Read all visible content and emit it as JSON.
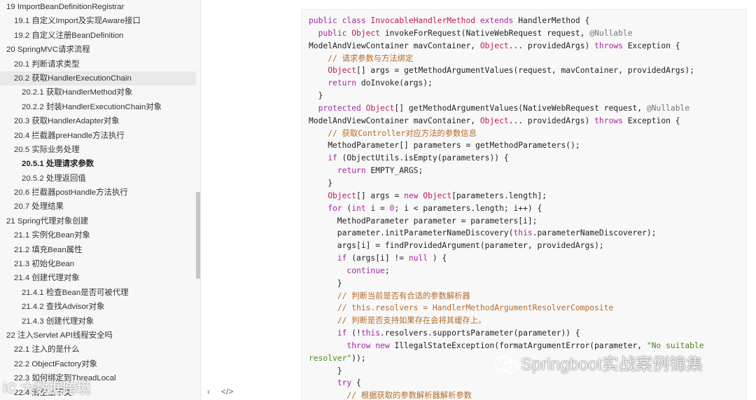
{
  "toc": [
    {
      "label": "19 ImportBeanDefinitionRegistrar",
      "level": 1
    },
    {
      "label": "19.1 自定义Import及实现Aware接口",
      "level": 2
    },
    {
      "label": "19.2 自定义注册BeanDefinition",
      "level": 2
    },
    {
      "label": "20 SpringMVC请求流程",
      "level": 1
    },
    {
      "label": "20.1 判断请求类型",
      "level": 2
    },
    {
      "label": "20.2 获取HandlerExecutionChain",
      "level": 2,
      "active": true
    },
    {
      "label": "20.2.1 获取HandlerMethod对象",
      "level": 3
    },
    {
      "label": "20.2.2 封装HandlerExecutionChain对象",
      "level": 3
    },
    {
      "label": "20.3 获取HandlerAdapter对象",
      "level": 2
    },
    {
      "label": "20.4 拦截器preHandle方法执行",
      "level": 2
    },
    {
      "label": "20.5 实际业务处理",
      "level": 2
    },
    {
      "label": "20.5.1 处理请求参数",
      "level": 3,
      "bold": true
    },
    {
      "label": "20.5.2 处理返回值",
      "level": 3
    },
    {
      "label": "20.6 拦截器postHandle方法执行",
      "level": 2
    },
    {
      "label": "20.7 处理结果",
      "level": 2
    },
    {
      "label": "21 Spring代理对象创建",
      "level": 1
    },
    {
      "label": "21.1 实例化Bean对象",
      "level": 2
    },
    {
      "label": "21.2 填充Bean属性",
      "level": 2
    },
    {
      "label": "21.3 初始化Bean",
      "level": 2
    },
    {
      "label": "21.4 创建代理对象",
      "level": 2
    },
    {
      "label": "21.4.1 检查Bean是否可被代理",
      "level": 3
    },
    {
      "label": "21.4.2 查找Advisor对象",
      "level": 3
    },
    {
      "label": "21.4.3 创建代理对象",
      "level": 3
    },
    {
      "label": "22 注入Servlet API线程安全吗",
      "level": 1
    },
    {
      "label": "22.1 注入的是什么",
      "level": 2
    },
    {
      "label": "22.2 ObjectFactory对象",
      "level": 2
    },
    {
      "label": "22.3 如何绑定到ThreadLocal",
      "level": 2
    },
    {
      "label": "22.4 清空上下文",
      "level": 2
    }
  ],
  "footer": {
    "collapse_label": "‹",
    "code_label": "</>"
  },
  "code_lines": [
    [
      [
        "kw",
        "public class "
      ],
      [
        "ty",
        "InvocableHandlerMethod"
      ],
      [
        "kw",
        " extends "
      ],
      [
        "",
        "HandlerMethod {"
      ]
    ],
    [
      [
        "",
        "  "
      ],
      [
        "kw",
        "public "
      ],
      [
        "ty",
        "Object"
      ],
      [
        "",
        " invokeForRequest(NativeWebRequest request, "
      ],
      [
        "an",
        "@Nullable"
      ]
    ],
    [
      [
        "",
        "ModelAndViewContainer mavContainer, "
      ],
      [
        "ty",
        "Object"
      ],
      [
        "",
        "... providedArgs) "
      ],
      [
        "kw",
        "throws"
      ],
      [
        "",
        " Exception {"
      ]
    ],
    [
      [
        "",
        "    "
      ],
      [
        "cm",
        "// 请求参数与方法绑定"
      ]
    ],
    [
      [
        "",
        "    "
      ],
      [
        "ty",
        "Object"
      ],
      [
        "",
        "[] args = getMethodArgumentValues(request, mavContainer, providedArgs);"
      ]
    ],
    [
      [
        "",
        "    "
      ],
      [
        "kw",
        "return"
      ],
      [
        "",
        " doInvoke(args);"
      ]
    ],
    [
      [
        "",
        "  }"
      ]
    ],
    [
      [
        "",
        "  "
      ],
      [
        "kw",
        "protected "
      ],
      [
        "ty",
        "Object"
      ],
      [
        "",
        "[] getMethodArgumentValues(NativeWebRequest request, "
      ],
      [
        "an",
        "@Nullable"
      ]
    ],
    [
      [
        "",
        "ModelAndViewContainer mavContainer, "
      ],
      [
        "ty",
        "Object"
      ],
      [
        "",
        "... providedArgs) "
      ],
      [
        "kw",
        "throws"
      ],
      [
        "",
        " Exception {"
      ]
    ],
    [
      [
        "",
        "    "
      ],
      [
        "cm",
        "// 获取Controller对应方法的参数信息"
      ]
    ],
    [
      [
        "",
        "    MethodParameter[] parameters = getMethodParameters();"
      ]
    ],
    [
      [
        "",
        "    "
      ],
      [
        "kw",
        "if"
      ],
      [
        "",
        " (ObjectUtils.isEmpty(parameters)) {"
      ]
    ],
    [
      [
        "",
        "      "
      ],
      [
        "kw",
        "return"
      ],
      [
        "",
        " EMPTY_ARGS;"
      ]
    ],
    [
      [
        "",
        "    }"
      ]
    ],
    [
      [
        "",
        "    "
      ],
      [
        "ty",
        "Object"
      ],
      [
        "",
        "[] args = "
      ],
      [
        "kw",
        "new "
      ],
      [
        "ty",
        "Object"
      ],
      [
        "",
        "[parameters.length];"
      ]
    ],
    [
      [
        "",
        "    "
      ],
      [
        "kw",
        "for"
      ],
      [
        "",
        " ("
      ],
      [
        "kw",
        "int"
      ],
      [
        "",
        " i = "
      ],
      [
        "kw",
        "0"
      ],
      [
        "",
        "; i < parameters.length; i++) {"
      ]
    ],
    [
      [
        "",
        "      MethodParameter parameter = parameters[i];"
      ]
    ],
    [
      [
        "",
        "      parameter.initParameterNameDiscovery("
      ],
      [
        "kw",
        "this"
      ],
      [
        "",
        ".parameterNameDiscoverer);"
      ]
    ],
    [
      [
        "",
        "      args[i] = findProvidedArgument(parameter, providedArgs);"
      ]
    ],
    [
      [
        "",
        "      "
      ],
      [
        "kw",
        "if"
      ],
      [
        "",
        " (args[i] != "
      ],
      [
        "kw",
        "null"
      ],
      [
        "",
        " ) {"
      ]
    ],
    [
      [
        "",
        "        "
      ],
      [
        "kw",
        "continue"
      ],
      [
        "",
        ";"
      ]
    ],
    [
      [
        "",
        "      }"
      ]
    ],
    [
      [
        "",
        "      "
      ],
      [
        "cm",
        "// 判断当前是否有合适的参数解析器"
      ]
    ],
    [
      [
        "",
        "      "
      ],
      [
        "cm",
        "// this.resolvers = HandlerMethodArgumentResolverComposite"
      ]
    ],
    [
      [
        "",
        "      "
      ],
      [
        "cm",
        "// 判断是否支持如果存在会将其缓存上。"
      ]
    ],
    [
      [
        "",
        "      "
      ],
      [
        "kw",
        "if"
      ],
      [
        "",
        " (!"
      ],
      [
        "kw",
        "this"
      ],
      [
        "",
        ".resolvers.supportsParameter(parameter)) {"
      ]
    ],
    [
      [
        "",
        "        "
      ],
      [
        "kw",
        "throw new"
      ],
      [
        "",
        " IllegalStateException(formatArgumentError(parameter, "
      ],
      [
        "st",
        "\"No suitable"
      ]
    ],
    [
      [
        "st",
        "resolver\""
      ],
      [
        "",
        "));"
      ]
    ],
    [
      [
        "",
        "      }"
      ]
    ],
    [
      [
        "",
        "      "
      ],
      [
        "kw",
        "try"
      ],
      [
        "",
        " {"
      ]
    ],
    [
      [
        "",
        "        "
      ],
      [
        "cm",
        "// 根据获取的参数解析器解析参数"
      ]
    ]
  ],
  "watermark_right": "Springboot实战案例锦集",
  "watermark_left": "iC 大数据跨境"
}
